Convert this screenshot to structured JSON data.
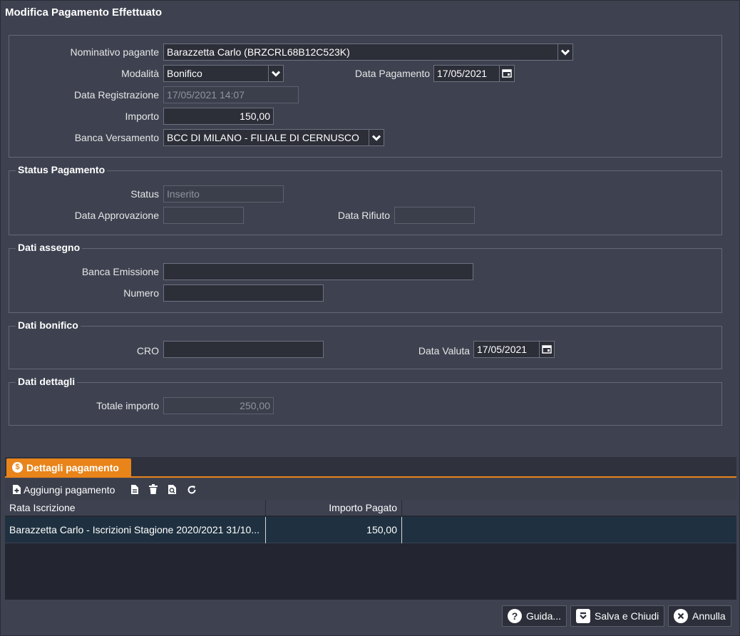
{
  "window": {
    "title": "Modifica Pagamento Effettuato"
  },
  "main": {
    "nominativo_label": "Nominativo pagante",
    "nominativo_value": "Barazzetta Carlo (BRZCRL68B12C523K)",
    "modalita_label": "Modalità",
    "modalita_value": "Bonifico",
    "data_pagamento_label": "Data Pagamento",
    "data_pagamento_value": "17/05/2021",
    "data_registrazione_label": "Data Registrazione",
    "data_registrazione_value": "17/05/2021 14:07",
    "importo_label": "Importo",
    "importo_value": "150,00",
    "banca_versamento_label": "Banca Versamento",
    "banca_versamento_value": "BCC DI MILANO - FILIALE DI CERNUSCO"
  },
  "status": {
    "legend": "Status Pagamento",
    "status_label": "Status",
    "status_value": "Inserito",
    "data_approvazione_label": "Data Approvazione",
    "data_approvazione_value": "",
    "data_rifiuto_label": "Data Rifiuto",
    "data_rifiuto_value": ""
  },
  "assegno": {
    "legend": "Dati assegno",
    "banca_emissione_label": "Banca Emissione",
    "banca_emissione_value": "",
    "numero_label": "Numero",
    "numero_value": ""
  },
  "bonifico": {
    "legend": "Dati bonifico",
    "cro_label": "CRO",
    "cro_value": "",
    "data_valuta_label": "Data Valuta",
    "data_valuta_value": "17/05/2021"
  },
  "dettagli": {
    "legend": "Dati dettagli",
    "totale_label": "Totale importo",
    "totale_value": "250,00"
  },
  "tab": {
    "label": "Dettagli pagamento",
    "icon": "dollar-circle-icon",
    "accent": "#e8841a"
  },
  "toolbar": {
    "add_label": "Aggiungi pagamento",
    "icons": [
      "add-document-icon",
      "document-icon",
      "trash-icon",
      "preview-icon",
      "refresh-icon"
    ]
  },
  "grid": {
    "columns": [
      "Rata Iscrizione",
      "Importo Pagato"
    ],
    "rows": [
      {
        "rata": "Barazzetta Carlo - Iscrizioni Stagione 2020/2021 31/10...",
        "importo": "150,00"
      }
    ]
  },
  "buttons": {
    "guida": "Guida...",
    "salva": "Salva e Chiudi",
    "annulla": "Annulla"
  }
}
